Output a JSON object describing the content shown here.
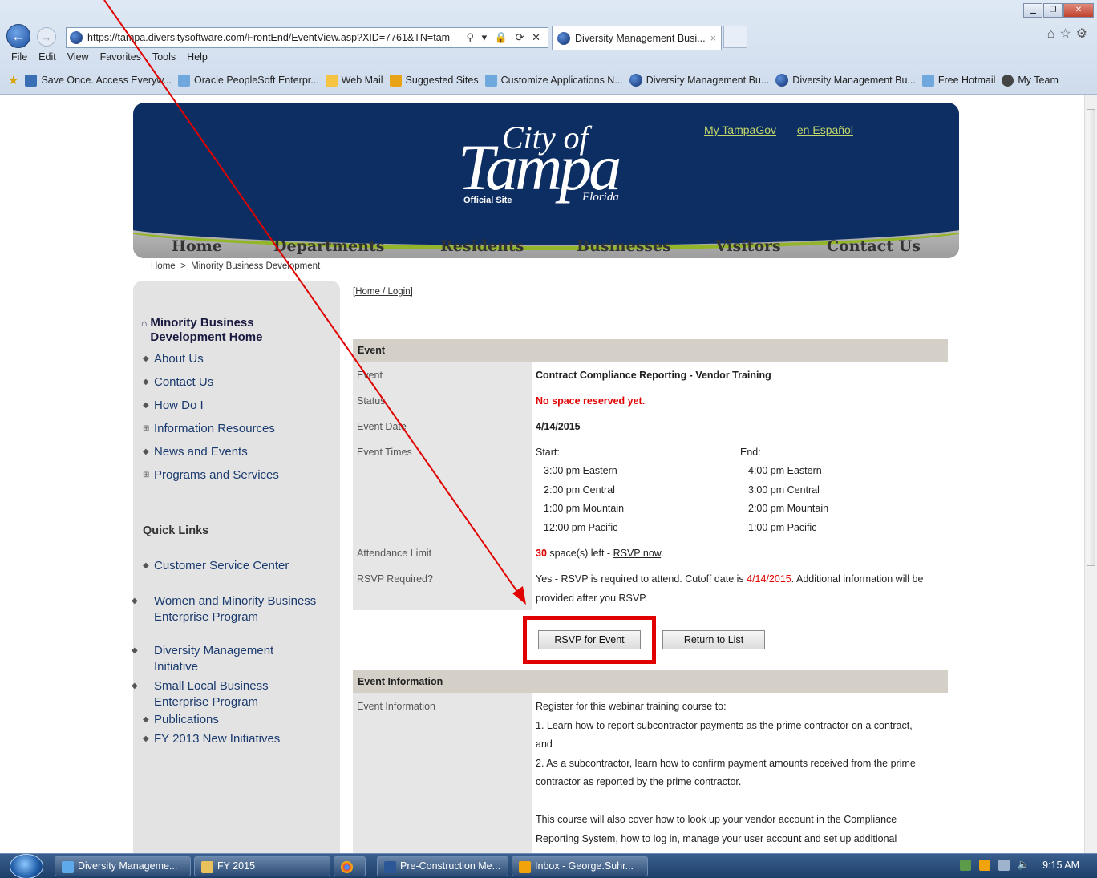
{
  "browser": {
    "url": "https://tampa.diversitysoftware.com/FrontEnd/EventView.asp?XID=7761&TN=tam",
    "address_icons": "⚲ ▾ 🔒 ⟳ ✕",
    "tab_title": "Diversity Management Busi...",
    "tab_close": "×",
    "menu": [
      "File",
      "Edit",
      "View",
      "Favorites",
      "Tools",
      "Help"
    ],
    "favorites": [
      "Save Once. Access Everyw...",
      "Oracle PeopleSoft Enterpr...",
      "Web Mail",
      "Suggested Sites",
      "Customize Applications N...",
      "Diversity Management Bu...",
      "Diversity Management Bu...",
      "Free Hotmail",
      "My Team"
    ]
  },
  "header": {
    "logo_city": "City of",
    "logo_tampa": "Tampa",
    "logo_official": "Official Site",
    "logo_florida": "Florida",
    "top_links": [
      "My TampaGov",
      "en Español"
    ],
    "nav": [
      "Home",
      "Departments",
      "Residents",
      "Businesses",
      "Visitors",
      "Contact Us"
    ]
  },
  "breadcrumb": "Home  >  Minority Business Development",
  "sidebar": {
    "home_title": "Minority Business Development Home",
    "items": [
      "About Us",
      "Contact Us",
      "How Do I",
      "Information Resources",
      "News and Events",
      "Programs and Services"
    ],
    "quick_links_title": "Quick Links",
    "quick_links": [
      "Customer Service Center",
      "Women and Minority Business Enterprise Program",
      "Diversity Management Initiative",
      "Small Local Business Enterprise Program",
      "Publications",
      "FY 2013 New Initiatives"
    ]
  },
  "content": {
    "login_link": "[Home / Login]",
    "event_section": "Event",
    "labels": {
      "event": "Event",
      "status": "Status",
      "event_date": "Event Date",
      "event_times": "Event Times",
      "attendance": "Attendance Limit",
      "rsvp_required": "RSVP Required?"
    },
    "event_name": "Contract Compliance Reporting - Vendor Training",
    "status": "No space reserved yet.",
    "event_date": "4/14/2015",
    "start_label": "Start:",
    "end_label": "End:",
    "start_times": [
      "3:00 pm Eastern",
      "2:00 pm Central",
      "1:00 pm Mountain",
      "12:00 pm Pacific"
    ],
    "end_times": [
      "4:00 pm Eastern",
      "3:00 pm Central",
      "2:00 pm Mountain",
      "1:00 pm Pacific"
    ],
    "spaces_left": "30",
    "spaces_text": " space(s) left - ",
    "rsvp_now": "RSVP now",
    "rsvp_req_1": "Yes - RSVP is required to attend. Cutoff date is ",
    "rsvp_cutoff": "4/14/2015",
    "rsvp_req_2": ". Additional information will be",
    "rsvp_req_3": "provided after you RSVP.",
    "btn_rsvp": "RSVP for Event",
    "btn_return": "Return to List",
    "info_section": "Event Information",
    "info_label": "Event Information",
    "info_lines": [
      "Register for this webinar training course to:",
      "1. Learn how to report subcontractor payments as the prime contractor on a contract,",
      "and",
      "2. As a subcontractor, learn how to confirm payment amounts received from the prime",
      "contractor as reported by the prime contractor.",
      "",
      "This course will also cover how to look up your vendor account in the Compliance",
      "Reporting System, how to log in, manage your user account and set up additional"
    ]
  },
  "taskbar": {
    "items": [
      "Diversity Manageme...",
      "FY 2015",
      "",
      "Pre-Construction Me...",
      "Inbox - George.Suhr..."
    ],
    "time": "9:15 AM"
  },
  "colors": {
    "banner_navy": "#0d2e62",
    "link_green": "#c3d86b",
    "alert_red": "#e00000"
  }
}
